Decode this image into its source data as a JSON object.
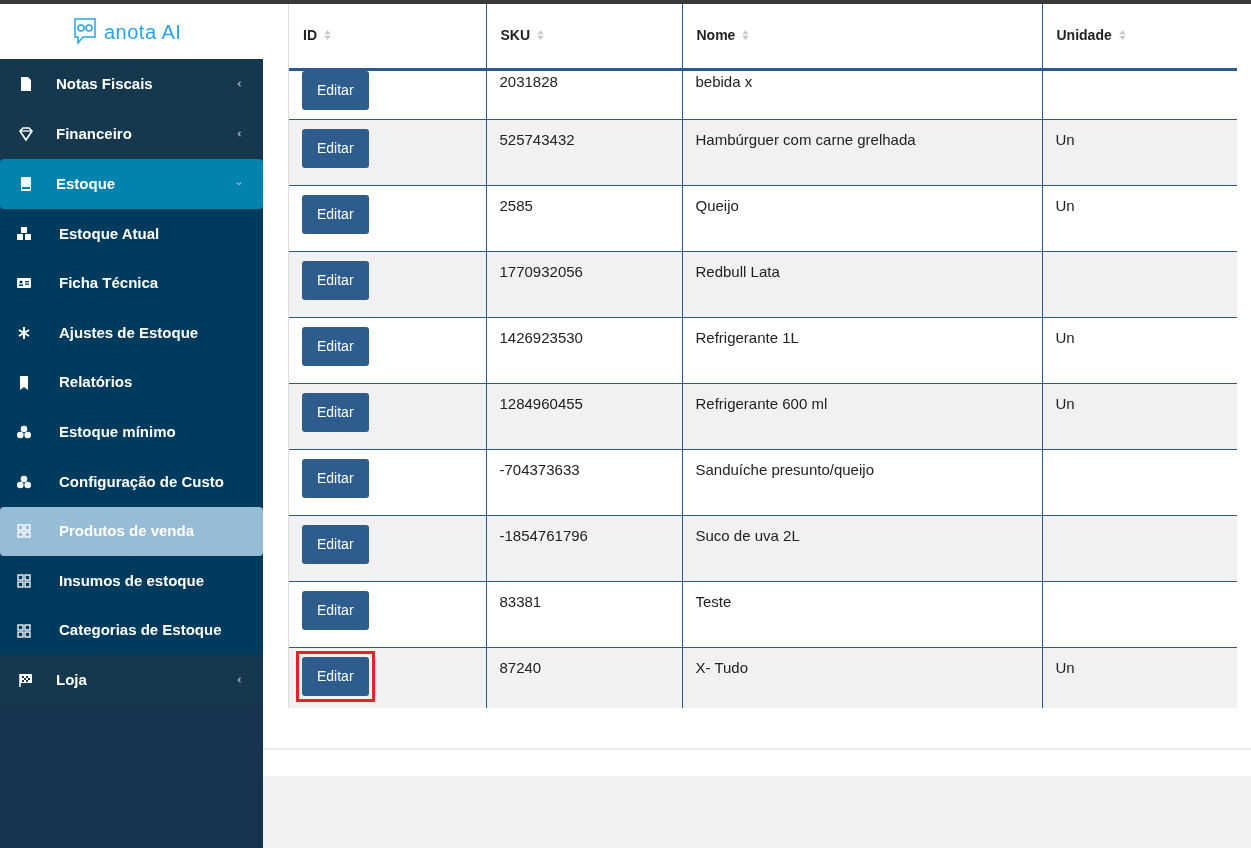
{
  "logo": {
    "text": "anota AI"
  },
  "sidebar": {
    "items": [
      {
        "kind": "group",
        "label": "Notas Fiscais",
        "selected": false,
        "expanded": false
      },
      {
        "kind": "group",
        "label": "Financeiro",
        "selected": false,
        "expanded": false
      },
      {
        "kind": "group",
        "label": "Estoque",
        "selected": true,
        "expanded": true,
        "children": [
          {
            "label": "Estoque Atual",
            "selected": false
          },
          {
            "label": "Ficha Técnica",
            "selected": false
          },
          {
            "label": "Ajustes de Estoque",
            "selected": false
          },
          {
            "label": "Relatórios",
            "selected": false
          },
          {
            "label": "Estoque mínimo",
            "selected": false
          },
          {
            "label": "Configuração de Custo",
            "selected": false
          },
          {
            "label": "Produtos de venda",
            "selected": true
          },
          {
            "label": "Insumos de estoque",
            "selected": false
          },
          {
            "label": "Categorias de Estoque",
            "selected": false
          }
        ]
      },
      {
        "kind": "group",
        "label": "Loja",
        "selected": false,
        "expanded": false
      }
    ]
  },
  "table": {
    "columns": [
      "ID",
      "SKU",
      "Nome",
      "Unidade"
    ],
    "rows": [
      {
        "button": "Editar",
        "sku": "2031828",
        "nome": "bebida x",
        "unidade": "",
        "highlighted": false
      },
      {
        "button": "Editar",
        "sku": "525743432",
        "nome": "Hambúrguer com carne grelhada",
        "unidade": "Un",
        "highlighted": false
      },
      {
        "button": "Editar",
        "sku": "2585",
        "nome": "Queijo",
        "unidade": "Un",
        "highlighted": false
      },
      {
        "button": "Editar",
        "sku": "1770932056",
        "nome": "Redbull Lata",
        "unidade": "",
        "highlighted": false
      },
      {
        "button": "Editar",
        "sku": "1426923530",
        "nome": "Refrigerante 1L",
        "unidade": "Un",
        "highlighted": false
      },
      {
        "button": "Editar",
        "sku": "1284960455",
        "nome": "Refrigerante 600 ml",
        "unidade": "Un",
        "highlighted": false
      },
      {
        "button": "Editar",
        "sku": "-704373633",
        "nome": "Sanduíche presunto/queijo",
        "unidade": "",
        "highlighted": false
      },
      {
        "button": "Editar",
        "sku": "-1854761796",
        "nome": "Suco de uva 2L",
        "unidade": "",
        "highlighted": false
      },
      {
        "button": "Editar",
        "sku": "83381",
        "nome": "Teste",
        "unidade": "",
        "highlighted": false
      },
      {
        "button": "Editar",
        "sku": "87240",
        "nome": "X- Tudo",
        "unidade": "Un",
        "highlighted": true
      }
    ]
  }
}
